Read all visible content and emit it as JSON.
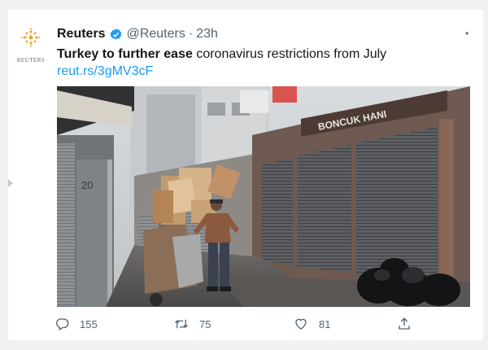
{
  "brand": {
    "accent": "#1d9bf0",
    "text": "#14171a",
    "muted": "#536471"
  },
  "tweet": {
    "avatar_icon": "reuters-logo-icon",
    "avatar_word": "REUTERS",
    "author_name": "Reuters",
    "verified_icon": "verified-badge-icon",
    "handle": "@Reuters",
    "separator": "·",
    "time": "23h",
    "more_icon": "more-dot-icon",
    "text_bold": "Turkey to further ease",
    "text_rest": " coronavirus restrictions from July ",
    "link": "reut.rs/3gMV3cF",
    "photo": {
      "icon": "news-photo",
      "shop_sign": "BONCUK HANI",
      "shutter_number": "20"
    },
    "actions": {
      "reply": {
        "icon": "reply-icon",
        "count": "155"
      },
      "retweet": {
        "icon": "retweet-icon",
        "count": "75"
      },
      "like": {
        "icon": "like-icon",
        "count": "81"
      },
      "share": {
        "icon": "share-icon"
      }
    }
  }
}
